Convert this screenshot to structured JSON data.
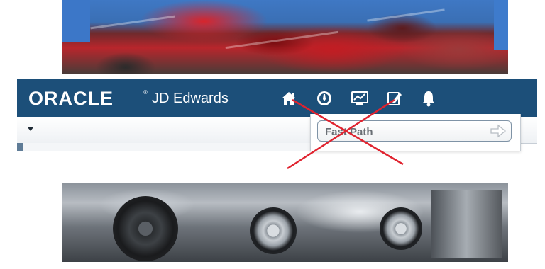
{
  "header": {
    "brand": "ORACLE",
    "registered_mark": "®",
    "product": "JD Edwards",
    "bar_color": "#1c4f79"
  },
  "nav_icons": [
    {
      "icon": "home-icon"
    },
    {
      "icon": "recent-icon"
    },
    {
      "icon": "watchlist-monitor-icon"
    },
    {
      "icon": "edit-note-icon"
    },
    {
      "icon": "bell-icon"
    }
  ],
  "fast_path": {
    "placeholder": "Fast Path",
    "go_icon": "arrow-right-icon"
  },
  "annotation": {
    "cross_color": "#e0232f"
  },
  "images": {
    "top": "crushed-red-cars-photo",
    "bottom": "crushed-silver-cars-photo"
  }
}
